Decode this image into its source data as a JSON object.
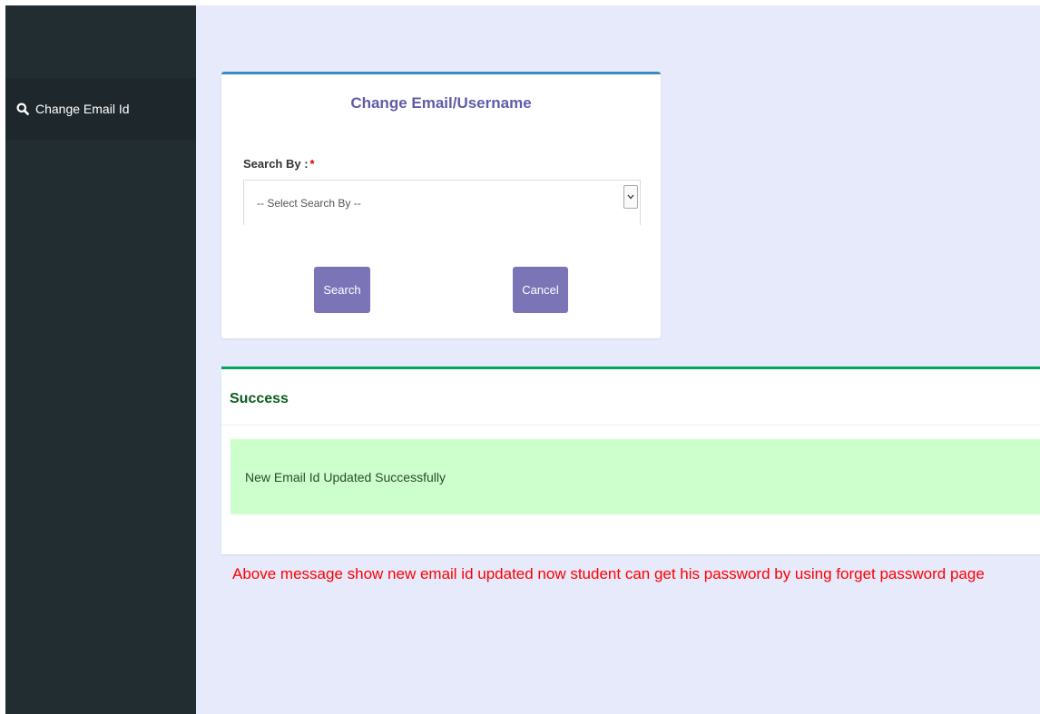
{
  "sidebar": {
    "items": [
      {
        "label": "Change Email Id",
        "icon": "search-icon"
      }
    ]
  },
  "search_card": {
    "title": "Change Email/Username",
    "search_by_label": "Search By :",
    "required_marker": "*",
    "select_placeholder": "-- Select Search By --",
    "search_button": "Search",
    "cancel_button": "Cancel"
  },
  "success_card": {
    "title": "Success",
    "message": "New Email Id Updated Successfully"
  },
  "annotation": "Above message show new email id updated now student can get his password by using forget password page",
  "colors": {
    "sidebar_bg": "#222d32",
    "content_bg": "#e6eafb",
    "accent_purple": "#7b75b8",
    "title_purple": "#605ca8",
    "success_green": "#00a65a",
    "alert_bg": "#ccffcc",
    "note_red": "#ff0000"
  }
}
